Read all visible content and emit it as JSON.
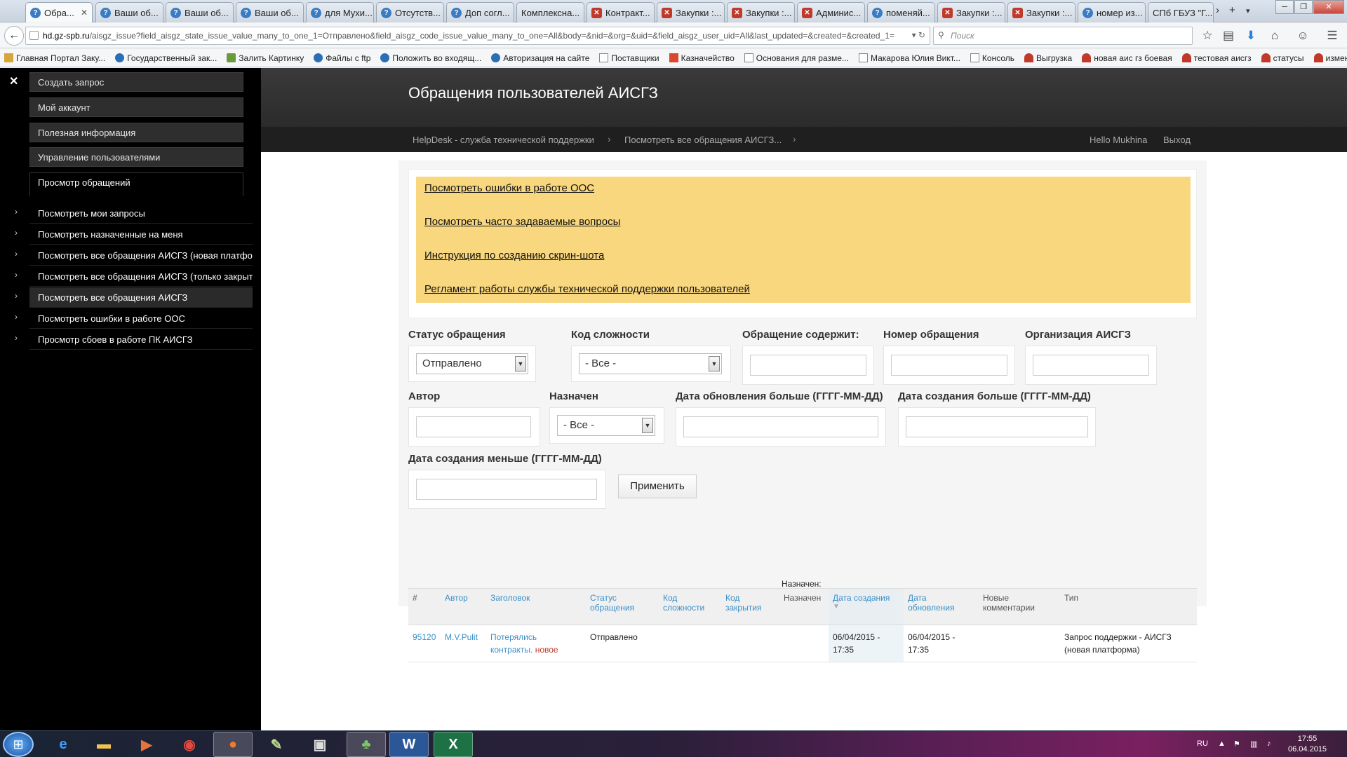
{
  "browser": {
    "tabs": [
      {
        "label": "Обра...",
        "active": true,
        "icon": "blue"
      },
      {
        "label": "Ваши об...",
        "icon": "blue"
      },
      {
        "label": "Ваши об...",
        "icon": "blue"
      },
      {
        "label": "Ваши об...",
        "icon": "blue"
      },
      {
        "label": "для Мухи...",
        "icon": "blue"
      },
      {
        "label": "Отсутств...",
        "icon": "blue"
      },
      {
        "label": "Доп согл...",
        "icon": "blue"
      },
      {
        "label": "Комплексна...",
        "icon": "none"
      },
      {
        "label": "Контракт...",
        "icon": "red"
      },
      {
        "label": "Закупки :...",
        "icon": "red"
      },
      {
        "label": "Закупки :...",
        "icon": "red"
      },
      {
        "label": "Админис...",
        "icon": "red"
      },
      {
        "label": "поменяй...",
        "icon": "blue"
      },
      {
        "label": "Закупки :...",
        "icon": "red"
      },
      {
        "label": "Закупки :...",
        "icon": "red"
      },
      {
        "label": "номер из...",
        "icon": "blue"
      },
      {
        "label": "СПб ГБУЗ \"Г...",
        "icon": "none"
      }
    ],
    "url_host": "hd.gz-spb.ru",
    "url_rest": "/aisgz_issue?field_aisgz_state_issue_value_many_to_one_1=Отправлено&field_aisgz_code_issue_value_many_to_one=All&body=&nid=&org=&uid=&field_aisgz_user_uid=All&last_updated=&created=&created_1=",
    "search_placeholder": "Поиск",
    "bookmarks": [
      {
        "label": "Главная Портал Заку...",
        "icon": "gold"
      },
      {
        "label": "Государственный зак...",
        "icon": "blue"
      },
      {
        "label": "Залить Картинку",
        "icon": "green"
      },
      {
        "label": "Файлы с ftp",
        "icon": "blue"
      },
      {
        "label": "Положить во входящ...",
        "icon": "blue"
      },
      {
        "label": "Авторизация на сайте",
        "icon": "blue"
      },
      {
        "label": "Поставщики",
        "icon": "blank"
      },
      {
        "label": "Казначейство",
        "icon": "red"
      },
      {
        "label": "Основания для разме...",
        "icon": "blank"
      },
      {
        "label": "Макарова Юлия Викт...",
        "icon": "blank"
      },
      {
        "label": "Консоль",
        "icon": "blank"
      },
      {
        "label": "Выгрузка",
        "icon": "red"
      },
      {
        "label": "новая аис гз боевая",
        "icon": "red"
      },
      {
        "label": "тестовая аисгз",
        "icon": "red"
      },
      {
        "label": "статусы",
        "icon": "red"
      },
      {
        "label": "изменения",
        "icon": "red"
      }
    ]
  },
  "sidebar": {
    "close_glyph": "✕",
    "buttons": [
      {
        "label": "Создать запрос"
      },
      {
        "label": "Мой аккаунт"
      },
      {
        "label": "Полезная информация"
      },
      {
        "label": "Управление пользователями"
      },
      {
        "label": "Просмотр обращений"
      }
    ],
    "items": [
      {
        "label": "Посмотреть мои запросы"
      },
      {
        "label": "Посмотреть назначенные на меня"
      },
      {
        "label": "Посмотреть все обращения АИСГЗ (новая платфор"
      },
      {
        "label": "Посмотреть все обращения АИСГЗ (только закрыть"
      },
      {
        "label": "Посмотреть все обращения АИСГЗ"
      },
      {
        "label": "Посмотреть ошибки в работе ООС"
      },
      {
        "label": "Просмотр сбоев в работе ПК АИСГЗ"
      }
    ]
  },
  "header": {
    "title": "Обращения пользователей АИСГЗ",
    "breadcrumb": [
      "HelpDesk - служба технической поддержки",
      "Посмотреть все обращения АИСГЗ..."
    ],
    "greeting": "Hello Mukhina",
    "logout": "Выход"
  },
  "notice": {
    "links": [
      "Посмотреть ошибки в работе ООС",
      "Посмотреть часто задаваемые вопросы",
      "Инструкция по созданию скрин-шота",
      "Регламент работы службы технической поддержки пользователей"
    ]
  },
  "filters": {
    "status_label": "Статус обращения",
    "status_value": "Отправлено",
    "complexity_label": "Код сложности",
    "complexity_value": "- Все -",
    "contains_label": "Обращение содержит:",
    "number_label": "Номер обращения",
    "org_label": "Организация АИСГЗ",
    "author_label": "Автор",
    "assigned_label": "Назначен",
    "assigned_value": "- Все -",
    "updated_gt_label": "Дата обновления больше (ГГГГ-ММ-ДД)",
    "created_gt_label": "Дата создания больше (ГГГГ-ММ-ДД)",
    "created_lt_label": "Дата создания меньше (ГГГГ-ММ-ДД)",
    "apply": "Применить"
  },
  "results": {
    "assigned_note": "Назначен:",
    "columns": {
      "num": "#",
      "author": "Автор",
      "title": "Заголовок",
      "status_1": "Статус",
      "status_2": "обращения",
      "code_1": "Код",
      "code_2": "сложности",
      "close_1": "Код",
      "close_2": "закрытия",
      "assigned": "Назначен",
      "created": "Дата создания",
      "updated_1": "Дата",
      "updated_2": "обновления",
      "newcomments_1": "Новые",
      "newcomments_2": "комментарии",
      "type": "Тип"
    },
    "rows": [
      {
        "num": "95120",
        "author": "M.V.Pulit",
        "title_1": "Потерялись",
        "title_2": "контракты.",
        "badge": "новое",
        "status": "Отправлено",
        "code": "",
        "close": "",
        "assigned": "",
        "created_1": "06/04/2015 -",
        "created_2": "17:35",
        "updated_1": "06/04/2015 -",
        "updated_2": "17:35",
        "newcomments": "",
        "type_1": "Запрос поддержки - АИСГЗ",
        "type_2": "(новая платформа)"
      }
    ]
  },
  "taskbar": {
    "lang": "RU",
    "time": "17:55",
    "date": "06.04.2015"
  }
}
